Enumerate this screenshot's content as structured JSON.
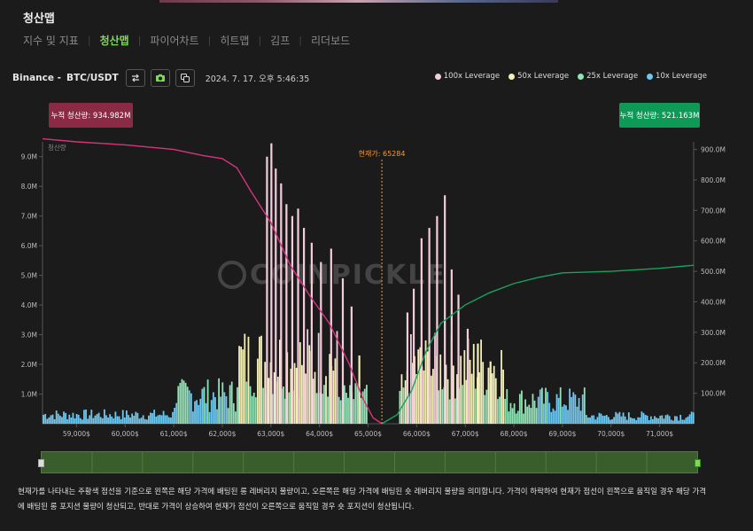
{
  "page": {
    "title": "청산맵"
  },
  "tabs": [
    {
      "label": "지수 및 지표",
      "active": false
    },
    {
      "label": "청산맵",
      "active": true
    },
    {
      "label": "파이어차트",
      "active": false
    },
    {
      "label": "히트맵",
      "active": false
    },
    {
      "label": "김프",
      "active": false
    },
    {
      "label": "리더보드",
      "active": false
    }
  ],
  "header": {
    "exchange": "Binance -",
    "pair": "BTC/USDT",
    "timestamp": "2024. 7. 17. 오후 5:46:35",
    "icons": [
      "swap-icon",
      "camera-icon",
      "copy-icon"
    ]
  },
  "legend": [
    {
      "label": "100x Leverage",
      "color": "#f4cddc"
    },
    {
      "label": "50x Leverage",
      "color": "#f4f0b8"
    },
    {
      "label": "25x Leverage",
      "color": "#8fe3b5"
    },
    {
      "label": "10x Leverage",
      "color": "#6fc8ef"
    }
  ],
  "cumulative": {
    "long_label": "누적 청산량: 934.982M",
    "short_label": "누적 청산량: 521.163M",
    "long_color": "#8a2a44",
    "short_color": "#0e9a56"
  },
  "chart_data": {
    "type": "bar",
    "title": "",
    "current_price_label": "현재가: 65284",
    "current_price": 65284,
    "watermark": "COINPICKLE",
    "left_axis_title": "청산량",
    "x_range": [
      58300,
      71700
    ],
    "x_ticks": [
      59000,
      60000,
      61000,
      62000,
      63000,
      64000,
      65000,
      66000,
      67000,
      68000,
      69000,
      70000,
      71000
    ],
    "x_tick_labels": [
      "59,000$",
      "60,000$",
      "61,000$",
      "62,000$",
      "63,000$",
      "64,000$",
      "65,000$",
      "66,000$",
      "67,000$",
      "68,000$",
      "69,000$",
      "70,000$",
      "71,000$"
    ],
    "y_left_range": [
      0,
      9.5
    ],
    "y_left_ticks": [
      1,
      2,
      3,
      4,
      5,
      6,
      7,
      8,
      9
    ],
    "y_left_tick_labels": [
      "1.0M",
      "2.0M",
      "3.0M",
      "4.0M",
      "5.0M",
      "6.0M",
      "7.0M",
      "8.0M",
      "9.0M"
    ],
    "y_right_range": [
      0,
      925
    ],
    "y_right_ticks": [
      100,
      200,
      300,
      400,
      500,
      600,
      700,
      800,
      900
    ],
    "y_right_tick_labels": [
      "100.0M",
      "200.0M",
      "300.0M",
      "400.0M",
      "500.0M",
      "600.0M",
      "700.0M",
      "800.0M",
      "900.0M"
    ],
    "left_bars": [
      [
        62920,
        9.0
      ],
      [
        63010,
        9.45
      ],
      [
        63100,
        8.6
      ],
      [
        63210,
        8.1
      ],
      [
        63320,
        7.4
      ],
      [
        63440,
        7.0
      ],
      [
        63560,
        7.25
      ],
      [
        63680,
        6.6
      ],
      [
        63840,
        6.1
      ],
      [
        64030,
        5.45
      ],
      [
        64240,
        5.9
      ],
      [
        64480,
        4.9
      ],
      [
        64660,
        3.95
      ],
      [
        64820,
        2.3
      ]
    ],
    "right_bars": [
      [
        65810,
        3.75
      ],
      [
        65940,
        4.55
      ],
      [
        66100,
        6.25
      ],
      [
        66260,
        6.6
      ],
      [
        66420,
        7.0
      ],
      [
        66580,
        7.7
      ],
      [
        66720,
        5.2
      ],
      [
        66860,
        4.35
      ],
      [
        67050,
        3.2
      ],
      [
        67260,
        2.7
      ],
      [
        67520,
        2.1
      ]
    ],
    "long_cumulative_line": [
      [
        58300,
        935
      ],
      [
        59000,
        925
      ],
      [
        60000,
        915
      ],
      [
        61000,
        900
      ],
      [
        61600,
        880
      ],
      [
        62000,
        870
      ],
      [
        62300,
        840
      ],
      [
        62600,
        760
      ],
      [
        63000,
        660
      ],
      [
        63400,
        520
      ],
      [
        63800,
        420
      ],
      [
        64200,
        330
      ],
      [
        64600,
        200
      ],
      [
        64900,
        80
      ],
      [
        65100,
        20
      ],
      [
        65284,
        0
      ]
    ],
    "short_cumulative_line": [
      [
        65284,
        0
      ],
      [
        65600,
        30
      ],
      [
        65900,
        110
      ],
      [
        66200,
        240
      ],
      [
        66500,
        330
      ],
      [
        67000,
        390
      ],
      [
        67500,
        430
      ],
      [
        68000,
        460
      ],
      [
        68500,
        480
      ],
      [
        69000,
        495
      ],
      [
        70000,
        500
      ],
      [
        71000,
        510
      ],
      [
        71700,
        520
      ]
    ]
  },
  "footnote": "현재가를 나타내는 주황색 점선을 기준으로 왼쪽은 해당 가격에 배팅된 롱 레버리지 물량이고, 오른쪽은 해당 가격에 배팅된 숏 레버리지 물량을 의미합니다. 가격이 하락하여 현재가 점선이 왼쪽으로 움직일 경우 해당 가격에 배팅된 롱 포지션 물량이 청산되고, 반대로 가격이 상승하여 현재가 점선이 오른쪽으로 움직일 경우 숏 포지션이 청산됩니다."
}
